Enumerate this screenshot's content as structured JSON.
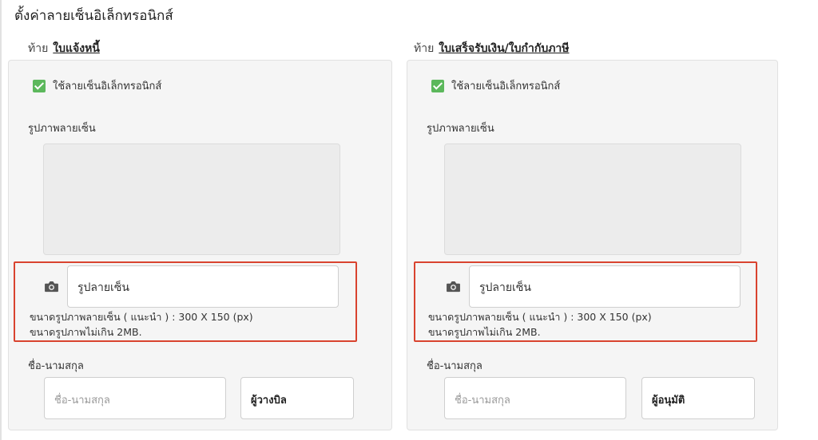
{
  "page": {
    "title": "ตั้งค่าลายเซ็นอิเล็กทรอนิกส์"
  },
  "left": {
    "prefix": "ท้าย",
    "doc_name": "ใบแจ้งหนี้",
    "checkbox_label": "ใช้ลายเซ็นอิเล็กทรอนิกส์",
    "checked": true,
    "image_label": "รูปภาพลายเซ็น",
    "upload_placeholder": "รูปลายเซ็น",
    "hint_size": "ขนาดรูปภาพลายเซ็น ( แนะนำ ) : 300 X 150 (px)",
    "hint_max": "ขนาดรูปภาพไม่เกิน 2MB.",
    "name_label": "ชื่อ-นามสกุล",
    "name_placeholder": "ชื่อ-นามสกุล",
    "role_value": "ผู้วางบิล"
  },
  "right": {
    "prefix": "ท้าย",
    "doc_name": "ใบเสร็จรับเงิน/ใบกำกับภาษี",
    "checkbox_label": "ใช้ลายเซ็นอิเล็กทรอนิกส์",
    "checked": true,
    "image_label": "รูปภาพลายเซ็น",
    "upload_placeholder": "รูปลายเซ็น",
    "hint_size": "ขนาดรูปภาพลายเซ็น ( แนะนำ ) : 300 X 150 (px)",
    "hint_max": "ขนาดรูปภาพไม่เกิน 2MB.",
    "name_label": "ชื่อ-นามสกุล",
    "name_placeholder": "ชื่อ-นามสกุล",
    "role_value": "ผู้อนุมัติ"
  },
  "colors": {
    "checkbox": "#5cb85c",
    "highlight": "#d9432f",
    "panel_bg": "#f5f5f5"
  },
  "icons": {
    "upload": "camera-icon"
  }
}
